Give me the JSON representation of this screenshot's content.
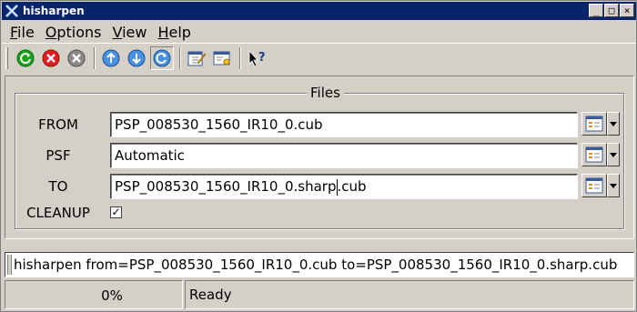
{
  "window": {
    "title": "hisharpen"
  },
  "menu": [
    {
      "label": "File",
      "u": "F",
      "rest": "ile"
    },
    {
      "label": "Options",
      "u": "O",
      "rest": "ptions"
    },
    {
      "label": "View",
      "u": "V",
      "rest": "iew"
    },
    {
      "label": "Help",
      "u": "H",
      "rest": "elp"
    }
  ],
  "menu_labels": {
    "file_u": "F",
    "file_rest": "ile",
    "options_u": "O",
    "options_rest": "ptions",
    "view_u": "V",
    "view_rest": "iew",
    "help_u": "H",
    "help_rest": "elp"
  },
  "toolbar": {
    "icons": [
      "run-icon",
      "stop-icon",
      "reset-icon",
      "back-icon",
      "forward-icon",
      "refresh-icon",
      "edit-icon",
      "preferences-icon",
      "whats-this-icon"
    ]
  },
  "files": {
    "group_title": "Files",
    "from": {
      "label": "FROM",
      "value": "PSP_008530_1560_IR10_0.cub"
    },
    "psf": {
      "label": "PSF",
      "value": "Automatic"
    },
    "to": {
      "label": "TO",
      "value_before_caret": "PSP_008530_1560_IR10_0.sharp",
      "value_after_caret": ".cub"
    },
    "cleanup": {
      "label": "CLEANUP",
      "checked": true,
      "mark": "✓"
    }
  },
  "command_line": "hisharpen from=PSP_008530_1560_IR10_0.cub to=PSP_008530_1560_IR10_0.sharp.cub",
  "status": {
    "progress": "0%",
    "message": "Ready"
  },
  "colors": {
    "titlebar": "#0a246a",
    "panel": "#d4d0c8"
  }
}
